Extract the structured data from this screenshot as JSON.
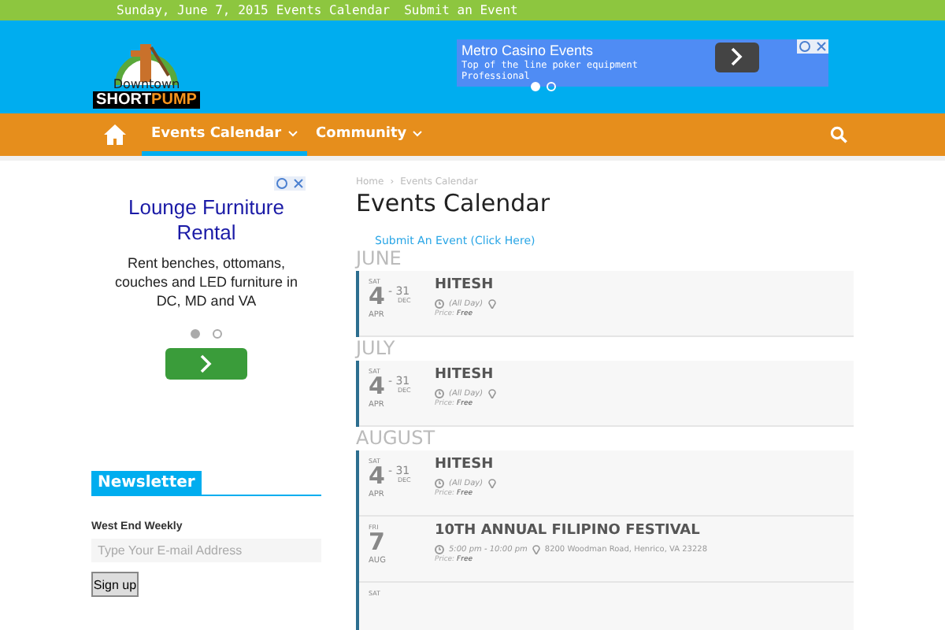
{
  "top_bar": {
    "date": "Sunday, June 7, 2015",
    "links": [
      "Events Calendar",
      "Submit an Event"
    ]
  },
  "logo": {
    "line1": "Downtown",
    "line2a": "SHORT",
    "line2b": "PUMP"
  },
  "header_ad": {
    "title": "Metro Casino Events",
    "text": "Top of the line poker equipment Professional",
    "dots": [
      {
        "selected": true
      },
      {
        "selected": false
      }
    ]
  },
  "nav": {
    "items": [
      {
        "label": "Events Calendar",
        "selected": true
      },
      {
        "label": "Community",
        "selected": false
      }
    ]
  },
  "sidebar_ad": {
    "title": "Lounge Furniture Rental",
    "text": "Rent benches, ottomans, couches and LED furniture in DC, MD and VA",
    "dots": [
      {
        "selected": true
      },
      {
        "selected": false
      }
    ]
  },
  "newsletter": {
    "heading": "Newsletter",
    "label": "West End Weekly",
    "placeholder": "Type Your E-mail Address",
    "button": "Sign up"
  },
  "breadcrumb": [
    "Home",
    "›",
    "Events Calendar"
  ],
  "page_title": "Events Calendar",
  "submit_link": "Submit An Event (Click Here)",
  "months": [
    {
      "name": "JUNE",
      "events": [
        {
          "dow": "SAT",
          "day": "4",
          "month": "APR",
          "end_day": "- 31",
          "end_month": "DEC",
          "title": "HITESH",
          "time": "(All Day)",
          "price_label": "Price:",
          "price": "Free"
        }
      ]
    },
    {
      "name": "JULY",
      "events": [
        {
          "dow": "SAT",
          "day": "4",
          "month": "APR",
          "end_day": "- 31",
          "end_month": "DEC",
          "title": "HITESH",
          "time": "(All Day)",
          "price_label": "Price:",
          "price": "Free"
        }
      ]
    },
    {
      "name": "AUGUST",
      "events": [
        {
          "dow": "SAT",
          "day": "4",
          "month": "APR",
          "end_day": "- 31",
          "end_month": "DEC",
          "title": "HITESH",
          "time": "(All Day)",
          "price_label": "Price:",
          "price": "Free"
        },
        {
          "dow": "FRI",
          "day": "7",
          "month": "AUG",
          "title": "10TH ANNUAL FILIPINO FESTIVAL",
          "time": "5:00 pm - 10:00 pm",
          "location": "8200 Woodman Road, Henrico, VA 23228",
          "price_label": "Price:",
          "price": "Free"
        },
        {
          "dow": "SAT"
        }
      ]
    }
  ]
}
